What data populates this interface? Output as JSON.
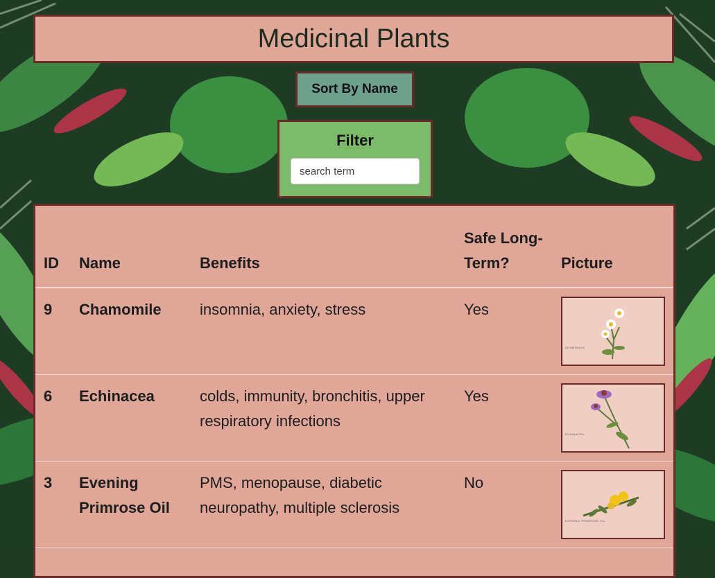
{
  "page": {
    "title": "Medicinal Plants"
  },
  "controls": {
    "sort_label": "Sort By Name",
    "filter_label": "Filter",
    "filter_placeholder": "search term",
    "filter_value": ""
  },
  "table": {
    "headers": {
      "id": "ID",
      "name": "Name",
      "benefits": "Benefits",
      "safe": "Safe Long-Term?",
      "picture": "Picture"
    },
    "rows": [
      {
        "id": "9",
        "name": "Chamomile",
        "benefits": "insomnia, anxiety, stress",
        "safe": "Yes",
        "caption": "CHAMOMILE"
      },
      {
        "id": "6",
        "name": "Echinacea",
        "benefits": "colds, immunity, bronchitis, upper respiratory infections",
        "safe": "Yes",
        "caption": "ECHINACEA"
      },
      {
        "id": "3",
        "name": "Evening Primrose Oil",
        "benefits": "PMS, menopause, diabetic neuropathy, multiple sclerosis",
        "safe": "No",
        "caption": "EVENING PRIMROSE OIL"
      }
    ]
  },
  "colors": {
    "panel": "#e0a799",
    "border": "#6b2a2a",
    "sort_button": "#6fa08d",
    "filter_box": "#7bbb69"
  }
}
